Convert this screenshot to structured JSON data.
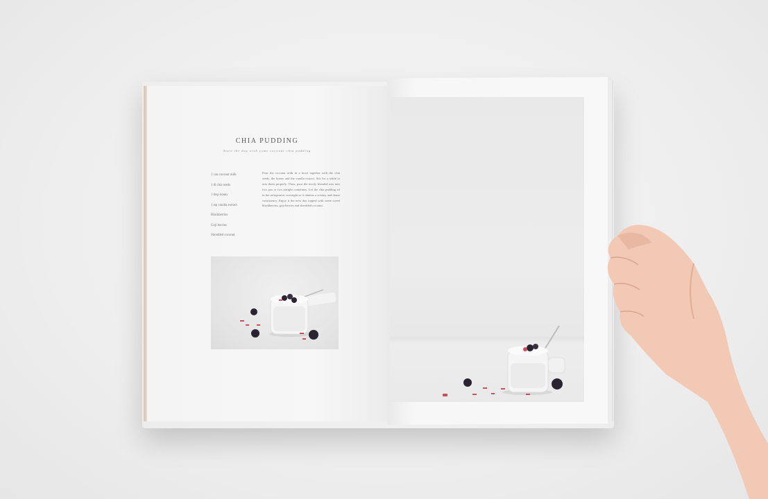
{
  "recipe": {
    "title": "Chia Pudding",
    "subtitle": "Start the day with some coconut chia pudding",
    "ingredients": [
      "1 can coconut milk",
      "1 dl chia seeds",
      "1 tbsp honey",
      "1 tsp vanilla extract",
      "Blackberries",
      "Goji berries",
      "Shredded coconut"
    ],
    "method": "Pour the coconut milk in a bowl together with the chia seeds, the honey and the vanilla extract. Stir for a while to mix them properly. Then, pour the nicely blended mix into two jars or two airtight containers. Let the chia pudding sit in the refrigerator overnight so it obtains a creamy and dense consistency. Enjoy it the next day topped with some sweet blackberries, goji berries and shredded coconut."
  },
  "colors": {
    "background": "#eeeeee",
    "page": "#f7f7f7",
    "spine_accent": "#d9cabb",
    "blackberry": "#2a2430",
    "goji": "#c8505a"
  }
}
